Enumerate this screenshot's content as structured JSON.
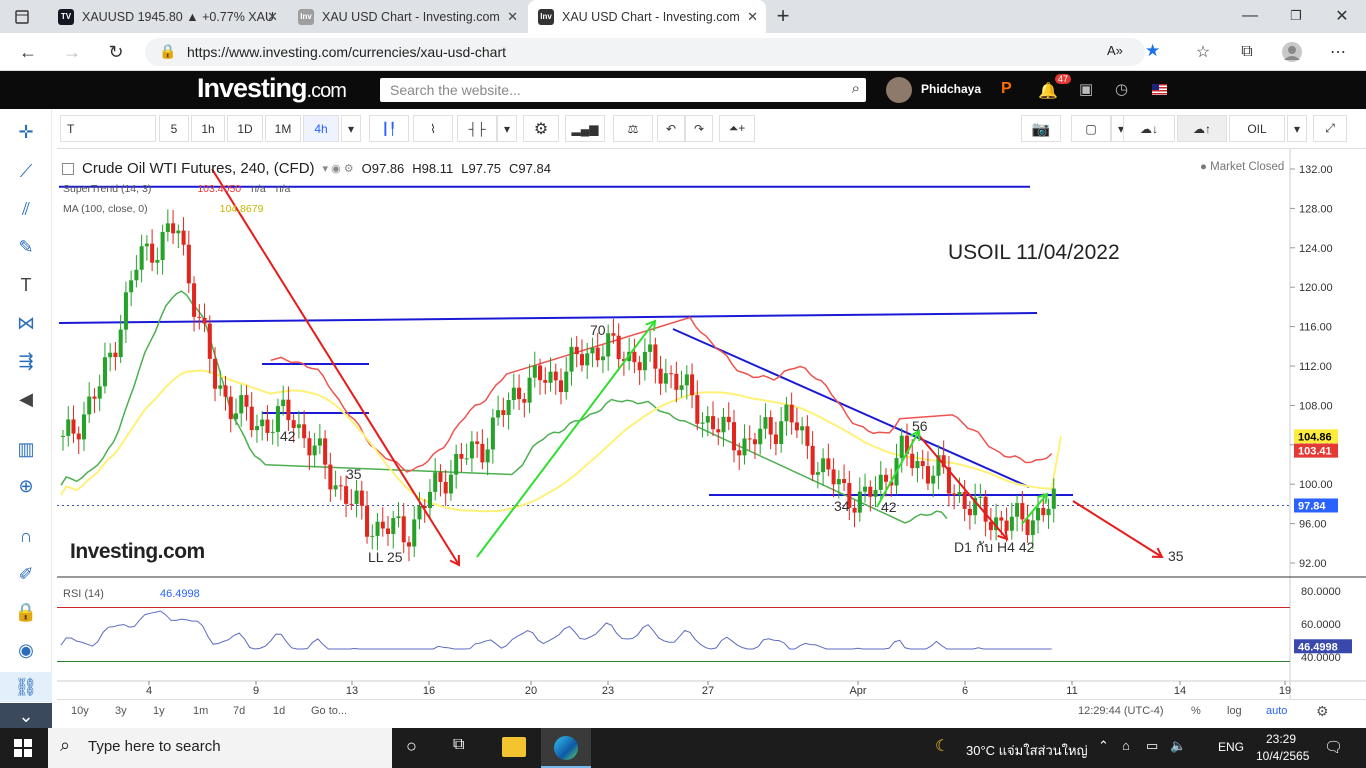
{
  "browser": {
    "tabs": [
      {
        "title": "XAUUSD 1945.80 ▲ +0.77% XAU",
        "icon": "tradingview-icon"
      },
      {
        "title": "XAU USD Chart - Investing.com",
        "icon": "investing-icon"
      },
      {
        "title": "XAU USD Chart - Investing.com",
        "icon": "investing-icon"
      }
    ],
    "url": "https://www.investing.com/currencies/xau-usd-chart"
  },
  "site": {
    "logo": "Investing",
    "logo_suffix": ".com",
    "search_placeholder": "Search the website...",
    "username": "Phidchaya",
    "notifications": "47"
  },
  "toolbar": {
    "symbol": "T",
    "intervals": [
      "5",
      "1h",
      "1D",
      "1M",
      "4h"
    ],
    "active_interval": "4h",
    "oil_label": "OIL"
  },
  "chart_header": {
    "title": "Crude Oil WTI Futures, 240, (CFD)",
    "open": "O97.86",
    "high": "H98.11",
    "low": "L97.75",
    "close": "C97.84",
    "supertrend_label": "SuperTrend (14, 3)",
    "supertrend_value": "103.4050",
    "supertrend_na1": "n/a",
    "supertrend_na2": "n/a",
    "ma_label": "MA (100, close, 0)",
    "ma_value": "104.8679",
    "market_status": "Market Closed",
    "watermark": "Investing.com"
  },
  "annotations": {
    "title": "USOIL 11/04/2022",
    "labels": [
      "70",
      "42",
      "35",
      "LL 25",
      "56",
      "34",
      "42",
      "D1 กับ H4 42",
      "35"
    ]
  },
  "price_axis": {
    "ticks": [
      "132.00",
      "128.00",
      "124.00",
      "120.00",
      "116.00",
      "112.00",
      "108.00",
      "104.00",
      "100.00",
      "96.00",
      "92.00"
    ],
    "badges": [
      {
        "value": "104.86",
        "color": "#ffeb3b",
        "text_color": "#000"
      },
      {
        "value": "103.41",
        "color": "#e53935",
        "text_color": "#fff"
      },
      {
        "value": "97.84",
        "color": "#2962ff",
        "text_color": "#fff"
      }
    ]
  },
  "rsi": {
    "label": "RSI (14)",
    "value": "46.4998",
    "ticks": [
      "80.0000",
      "60.0000",
      "40.0000"
    ],
    "badge": "46.4998"
  },
  "time_axis": {
    "ticks": [
      "4",
      "9",
      "13",
      "16",
      "20",
      "23",
      "27",
      "Apr",
      "6",
      "11",
      "14",
      "19"
    ]
  },
  "bottom_bar": {
    "ranges": [
      "10y",
      "3y",
      "1y",
      "1m",
      "7d",
      "1d",
      "Go to..."
    ],
    "time": "12:29:44 (UTC-4)",
    "pct": "%",
    "log": "log",
    "auto": "auto"
  },
  "taskbar": {
    "search_placeholder": "Type here to search",
    "weather": "30°C แจ่มใสส่วนใหญ่",
    "language": "ENG",
    "time": "23:29",
    "date": "10/4/2565"
  },
  "chart_data": {
    "type": "candlestick",
    "title": "Crude Oil WTI Futures, 240, (CFD)",
    "ylim": [
      90,
      133
    ],
    "x_ticks": [
      "4",
      "9",
      "13",
      "16",
      "20",
      "23",
      "27",
      "Apr",
      "6",
      "11",
      "14",
      "19"
    ],
    "close_path": [
      [
        "3 Mar",
        104
      ],
      [
        "4 Mar",
        110
      ],
      [
        "7 Mar",
        123
      ],
      [
        "8 Mar",
        126
      ],
      [
        "9 Mar",
        110
      ],
      [
        "10 Mar",
        106
      ],
      [
        "11 Mar",
        107
      ],
      [
        "14 Mar",
        101
      ],
      [
        "15 Mar",
        96
      ],
      [
        "16 Mar",
        95
      ],
      [
        "17 Mar",
        101
      ],
      [
        "18 Mar",
        104
      ],
      [
        "21 Mar",
        110
      ],
      [
        "22 Mar",
        111
      ],
      [
        "23 Mar",
        114
      ],
      [
        "24 Mar",
        113
      ],
      [
        "25 Mar",
        111
      ],
      [
        "28 Mar",
        106
      ],
      [
        "29 Mar",
        104
      ],
      [
        "30 Mar",
        107
      ],
      [
        "31 Mar",
        101
      ],
      [
        "1 Apr",
        98
      ],
      [
        "4 Apr",
        103
      ],
      [
        "5 Apr",
        101
      ],
      [
        "6 Apr",
        97
      ],
      [
        "7 Apr",
        96
      ],
      [
        "8 Apr",
        97.84
      ]
    ],
    "levels": {
      "resistance_top": 130.2,
      "resistance_mid": 117,
      "support": 99
    }
  }
}
